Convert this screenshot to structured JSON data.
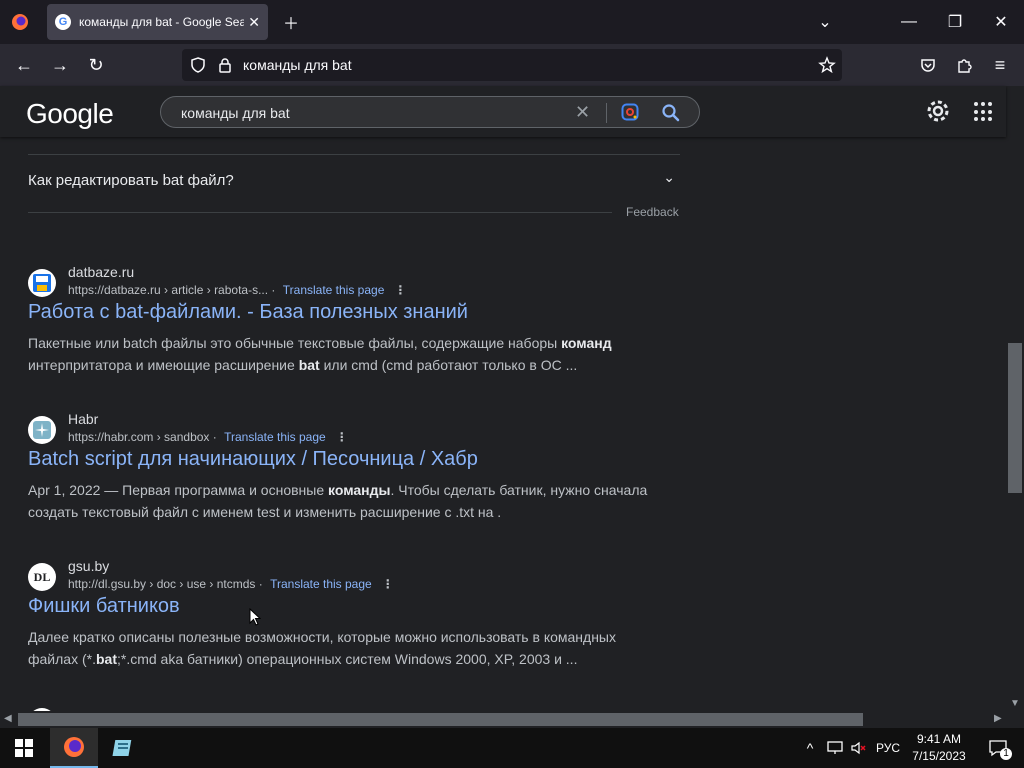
{
  "browser": {
    "tab_title": "команды для bat - Google Search",
    "address": "команды для bat"
  },
  "google": {
    "logo": "Google",
    "query": "команды для bat"
  },
  "faq": {
    "question": "Как редактировать bat файл?",
    "feedback": "Feedback"
  },
  "results": [
    {
      "favicon": "datbaze",
      "site": "datbaze.ru",
      "url": "https://datbaze.ru › article › rabota-s...",
      "translate": "Translate this page",
      "title": "Работа с bat-файлами. - База полезных знаний",
      "snippet_html": "Пакетные или batch файлы это обычные текстовые файлы, содержащие наборы <b>команд</b> интерпритатора и имеющие расширение <b>bat</b> или cmd (cmd работают только в ОС ..."
    },
    {
      "favicon": "habr",
      "site": "Habr",
      "url": "https://habr.com › sandbox",
      "translate": "Translate this page",
      "title": "Batch script для начинающих / Песочница / Хабр",
      "snippet_html": "Apr 1, 2022 — Первая программа и основные <b>команды</b>. Чтобы сделать батник, нужно сначала создать текстовый файл с именем test и изменить расширение с .txt на ."
    },
    {
      "favicon": "DL",
      "site": "gsu.by",
      "url": "http://dl.gsu.by › doc › use › ntcmds",
      "translate": "Translate this page",
      "title": "Фишки батников",
      "snippet_html": "Далее кратко описаны полезные возможности, которые можно использовать в командных файлах (*.<b>bat</b>;*.cmd aka батники) операционных систем Windows 2000, XP, 2003 и ..."
    }
  ],
  "taskbar": {
    "lang": "РУС",
    "time": "9:41 AM",
    "date": "7/15/2023",
    "notif_count": "1"
  },
  "colors": {
    "link": "#8ab4f8",
    "page_bg": "#202124",
    "accent_blue": "#4285f4"
  }
}
